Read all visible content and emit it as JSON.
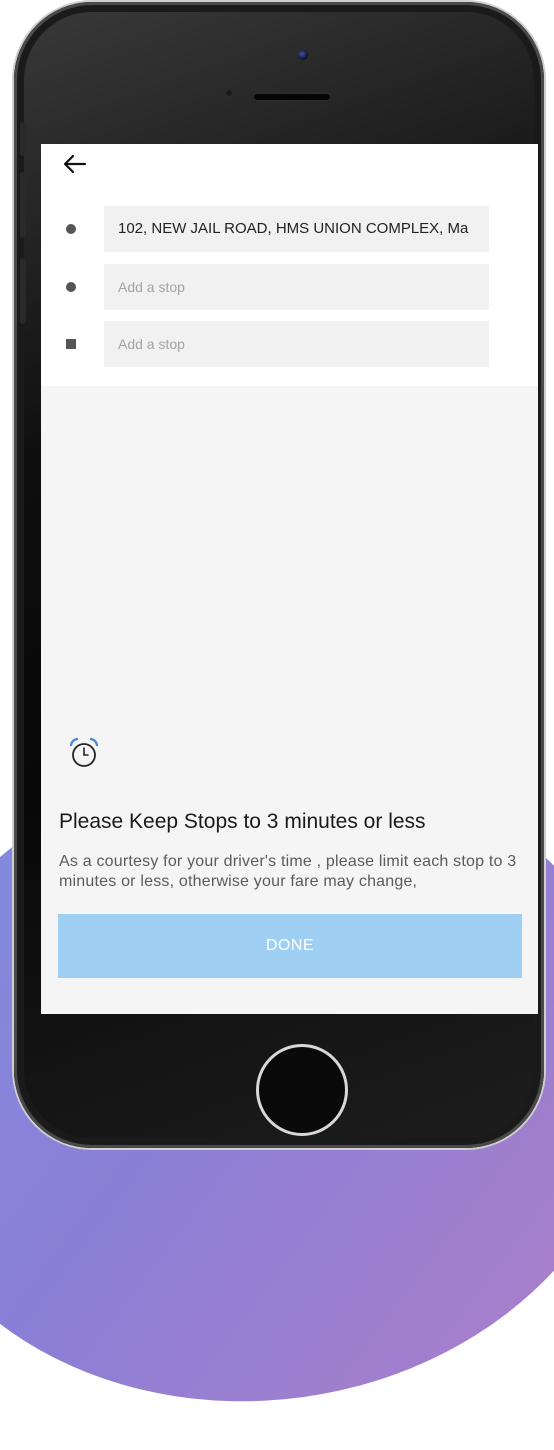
{
  "header": {
    "back_icon": "arrow-left-icon"
  },
  "stops": [
    {
      "bullet": "circle",
      "value": "102, NEW JAIL ROAD, HMS UNION COMPLEX, Ma",
      "placeholder": ""
    },
    {
      "bullet": "circle",
      "value": "",
      "placeholder": "Add a stop"
    },
    {
      "bullet": "square",
      "value": "",
      "placeholder": "Add a stop"
    }
  ],
  "notice": {
    "icon": "alarm-clock-icon",
    "title": "Please Keep Stops to 3 minutes or less",
    "body": "As a courtesy for your driver's time , please limit each stop to 3 minutes or less, otherwise your fare may change,"
  },
  "done_label": "DONE",
  "colors": {
    "done_button": "#9fd0f4",
    "alarm_accent": "#4a86d6"
  }
}
